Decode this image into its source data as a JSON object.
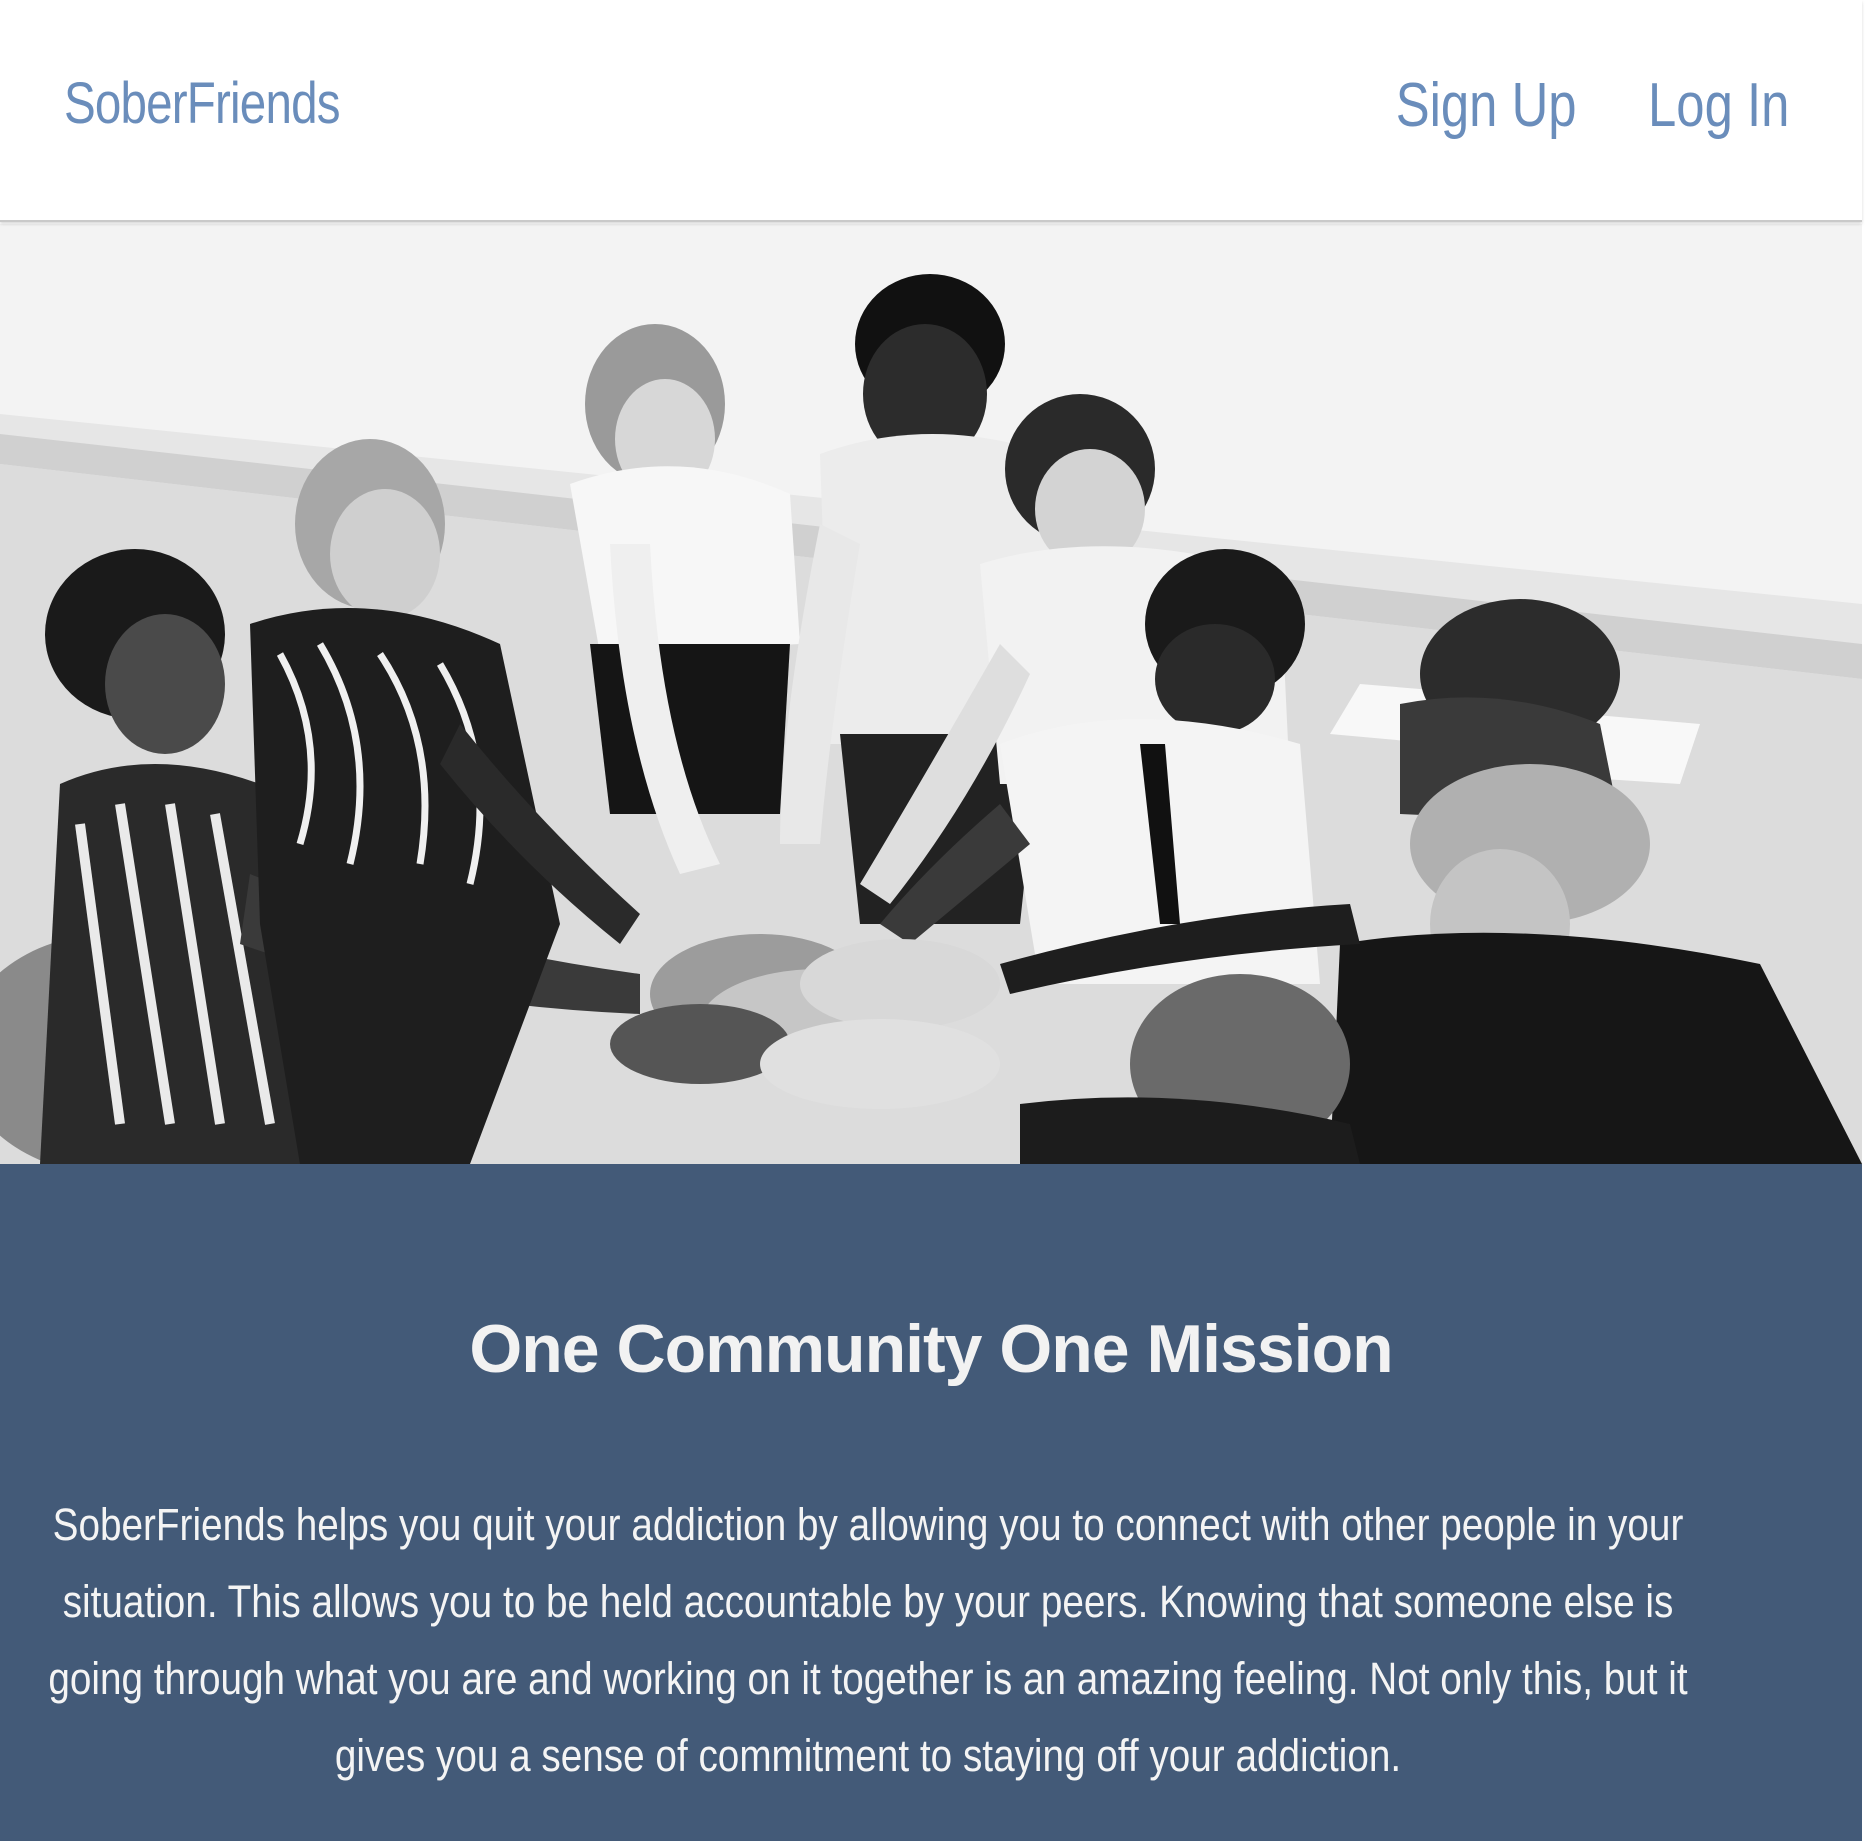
{
  "header": {
    "brand": "SoberFriends",
    "nav": {
      "signup_label": "Sign Up",
      "login_label": "Log In"
    }
  },
  "hero": {
    "image_subject": "group of people stacking hands together"
  },
  "mission": {
    "title": "One Community One Mission",
    "body": "SoberFriends helps you quit your addiction by allowing you to connect with other people in your situation. This allows you to be held accountable by your peers. Knowing that someone else is going through what you are and working on it together is an amazing feeling. Not only this, but it gives you a sense of commitment to staying off your addiction."
  },
  "colors": {
    "link": "#6a8dbb",
    "mission_background": "#435a78",
    "mission_text": "#f2f2f2"
  }
}
